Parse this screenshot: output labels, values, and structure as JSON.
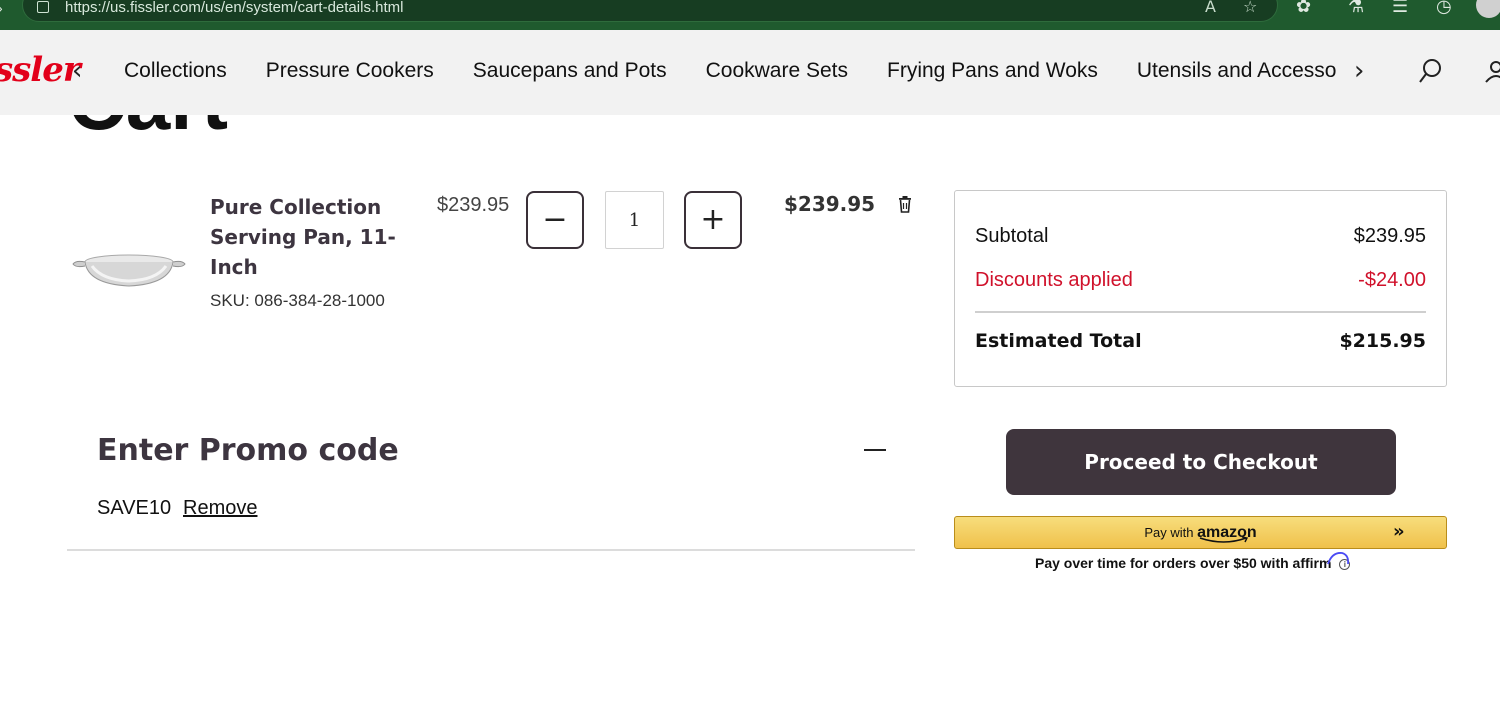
{
  "browser": {
    "url": "https://us.fissler.com/us/en/system/cart-details.html"
  },
  "site": {
    "logo_text": "ssler",
    "nav_items": [
      "Collections",
      "Pressure Cookers",
      "Saucepans and Pots",
      "Cookware Sets",
      "Frying Pans and Woks",
      "Utensils and Accessories"
    ],
    "prev_arrow": "‹",
    "next_arrow": "›"
  },
  "page": {
    "title": "Cart"
  },
  "cart": {
    "item": {
      "name": "Pure Collection Serving Pan, 11-Inch",
      "sku": "SKU: 086-384-28-1000",
      "unit_price": "$239.95",
      "quantity": "1",
      "line_total": "$239.95",
      "decrement_symbol": "−",
      "increment_symbol": "+"
    }
  },
  "summary": {
    "subtotal_label": "Subtotal",
    "subtotal_value": "$239.95",
    "discount_label": "Discounts applied",
    "discount_value": "-$24.00",
    "total_label": "Estimated Total",
    "total_value": "$215.95",
    "discount_color": "#d0112b"
  },
  "checkout": {
    "button_label": "Proceed to Checkout",
    "amazon_prefix": "Pay with",
    "amazon_word": "amazon",
    "amazon_chevrons": "»",
    "affirm_text": "Pay over time for orders over $50 with",
    "affirm_logo": "affirm"
  },
  "promo": {
    "title": "Enter Promo code",
    "code": "SAVE10",
    "remove_label": "Remove"
  },
  "colors": {
    "browser_bar": "#1f5a2e",
    "checkout_button": "#3f353d",
    "brand_red": "#e2001a",
    "amazon_yellow": "#f0c14b"
  }
}
